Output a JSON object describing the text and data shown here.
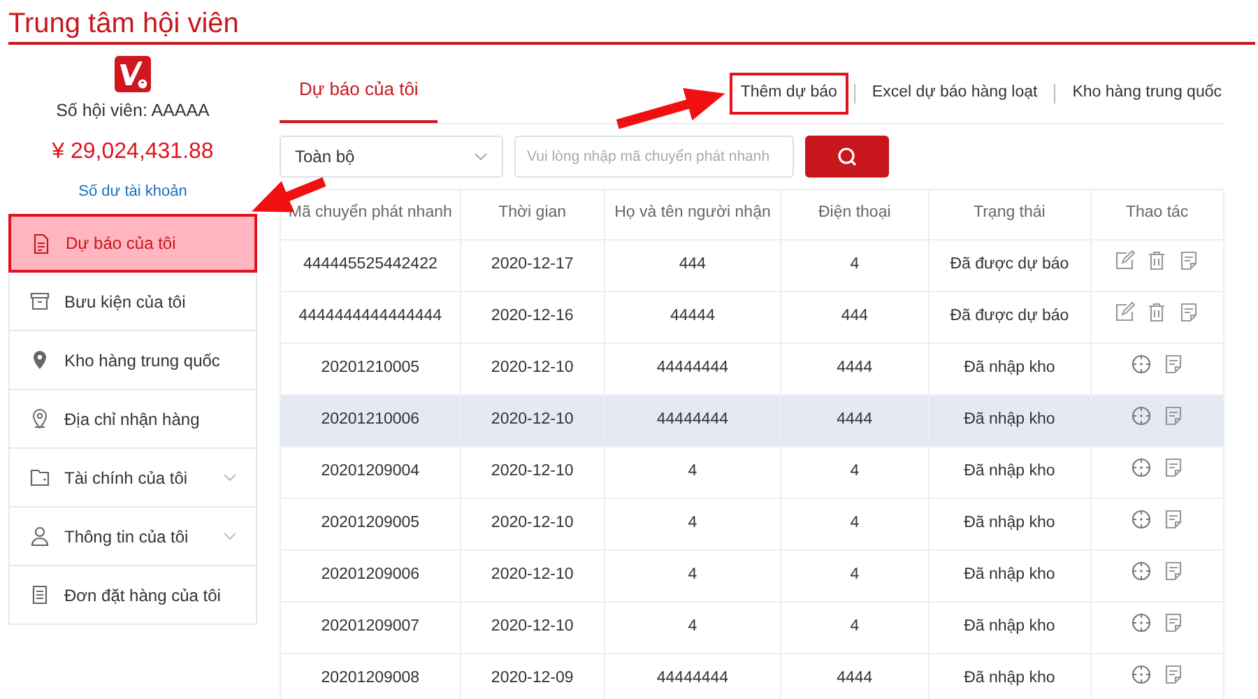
{
  "page_title": "Trung tâm hội viên",
  "profile": {
    "member": "Số hội viên: AAAAA",
    "balance": "¥ 29,024,431.88",
    "balance_link": "Số dư tài khoản"
  },
  "sidebar": {
    "items": [
      {
        "label": "Dự báo của tôi",
        "selected": true,
        "expandable": false
      },
      {
        "label": "Bưu kiện của tôi",
        "selected": false,
        "expandable": false
      },
      {
        "label": "Kho hàng trung quốc",
        "selected": false,
        "expandable": false
      },
      {
        "label": "Địa chỉ nhận hàng",
        "selected": false,
        "expandable": false
      },
      {
        "label": "Tài chính của tôi",
        "selected": false,
        "expandable": true
      },
      {
        "label": "Thông tin của tôi",
        "selected": false,
        "expandable": true
      },
      {
        "label": "Đơn đặt hàng của tôi",
        "selected": false,
        "expandable": false
      }
    ]
  },
  "tabs": [
    {
      "label": "Dự báo của tôi",
      "selected": true
    }
  ],
  "links": [
    {
      "label": "Thêm dự báo",
      "outlined": true
    },
    {
      "label": "Excel dự báo hàng loạt",
      "outlined": false
    },
    {
      "label": "Kho hàng trung quốc",
      "outlined": false
    }
  ],
  "filter": {
    "select_value": "Toàn bộ",
    "search_placeholder": "Vui lòng nhập mã chuyển phát nhanh"
  },
  "table": {
    "columns": [
      "Mã chuyển phát nhanh",
      "Thời gian",
      "Họ và tên người nhận",
      "Điện thoại",
      "Trạng thái",
      "Thao tác"
    ],
    "rows": [
      {
        "cells": [
          "444445525442422",
          "2020-12-17",
          "444",
          "4",
          "Đã được dự báo"
        ],
        "kind": "forecast",
        "selected": false
      },
      {
        "cells": [
          "4444444444444444",
          "2020-12-16",
          "44444",
          "444",
          "Đã được dự báo"
        ],
        "kind": "forecast",
        "selected": false
      },
      {
        "cells": [
          "20201210005",
          "2020-12-10",
          "44444444",
          "4444",
          "Đã nhập kho"
        ],
        "kind": "stored",
        "selected": false
      },
      {
        "cells": [
          "20201210006",
          "2020-12-10",
          "44444444",
          "4444",
          "Đã nhập kho"
        ],
        "kind": "stored",
        "selected": true
      },
      {
        "cells": [
          "20201209004",
          "2020-12-10",
          "4",
          "4",
          "Đã nhập kho"
        ],
        "kind": "stored",
        "selected": false
      },
      {
        "cells": [
          "20201209005",
          "2020-12-10",
          "4",
          "4",
          "Đã nhập kho"
        ],
        "kind": "stored",
        "selected": false
      },
      {
        "cells": [
          "20201209006",
          "2020-12-10",
          "4",
          "4",
          "Đã nhập kho"
        ],
        "kind": "stored",
        "selected": false
      },
      {
        "cells": [
          "20201209007",
          "2020-12-10",
          "4",
          "4",
          "Đã nhập kho"
        ],
        "kind": "stored",
        "selected": false
      },
      {
        "cells": [
          "20201209008",
          "2020-12-09",
          "44444444",
          "4444",
          "Đã nhập kho"
        ],
        "kind": "stored",
        "selected": false
      }
    ]
  },
  "annotations": [
    {
      "kind": "arrow"
    },
    {
      "kind": "arrow"
    }
  ]
}
